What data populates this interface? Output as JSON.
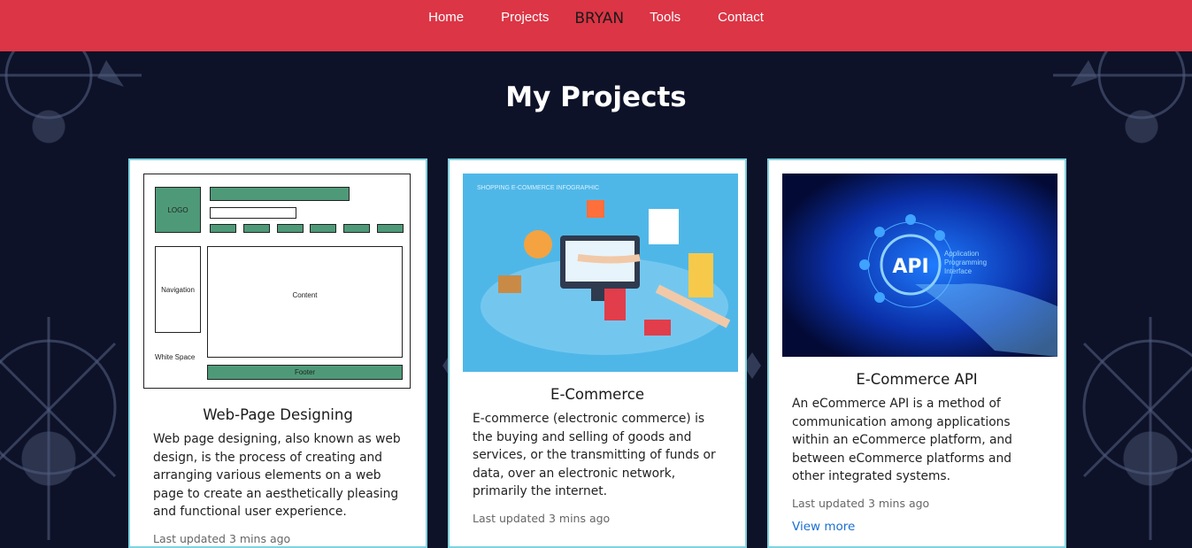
{
  "nav": {
    "items": [
      "Home",
      "Projects",
      "Tools",
      "Contact"
    ],
    "brand": "BRYAN"
  },
  "page_title": "My Projects",
  "colors": {
    "nav_bg": "#dc3545",
    "page_bg": "#0d1228",
    "card_border": "#7fd3e0",
    "link": "#1a6fd1",
    "wireframe_green": "#4e9a78"
  },
  "projects": [
    {
      "title": "Web-Page Designing",
      "description": "Web page designing, also known as web design, is the process of creating and arranging various elements on a web page to create an aesthetically pleasing and functional user experience.",
      "updated": "Last updated 3 mins ago",
      "image": {
        "type": "wireframe",
        "labels": {
          "logo": "LOGO",
          "navigation": "Navigation",
          "content": "Content",
          "white_space": "White Space",
          "footer": "Footer"
        }
      }
    },
    {
      "title": "E-Commerce",
      "description": "E-commerce (electronic commerce) is the buying and selling of goods and services, or the transmitting of funds or data, over an electronic network, primarily the internet.",
      "updated": "Last updated 3 mins ago",
      "image": {
        "type": "illustration",
        "caption": "SHOPPING E-COMMERCE INFOGRAPHIC"
      }
    },
    {
      "title": "E-Commerce API",
      "description": "An eCommerce API is a method of communication among applications within an eCommerce platform, and between eCommerce platforms and other integrated systems.",
      "updated": "Last updated 3 mins ago",
      "link": "View more",
      "image": {
        "type": "illustration",
        "label": "API",
        "sublabel": "Application Programming Interface"
      }
    }
  ]
}
